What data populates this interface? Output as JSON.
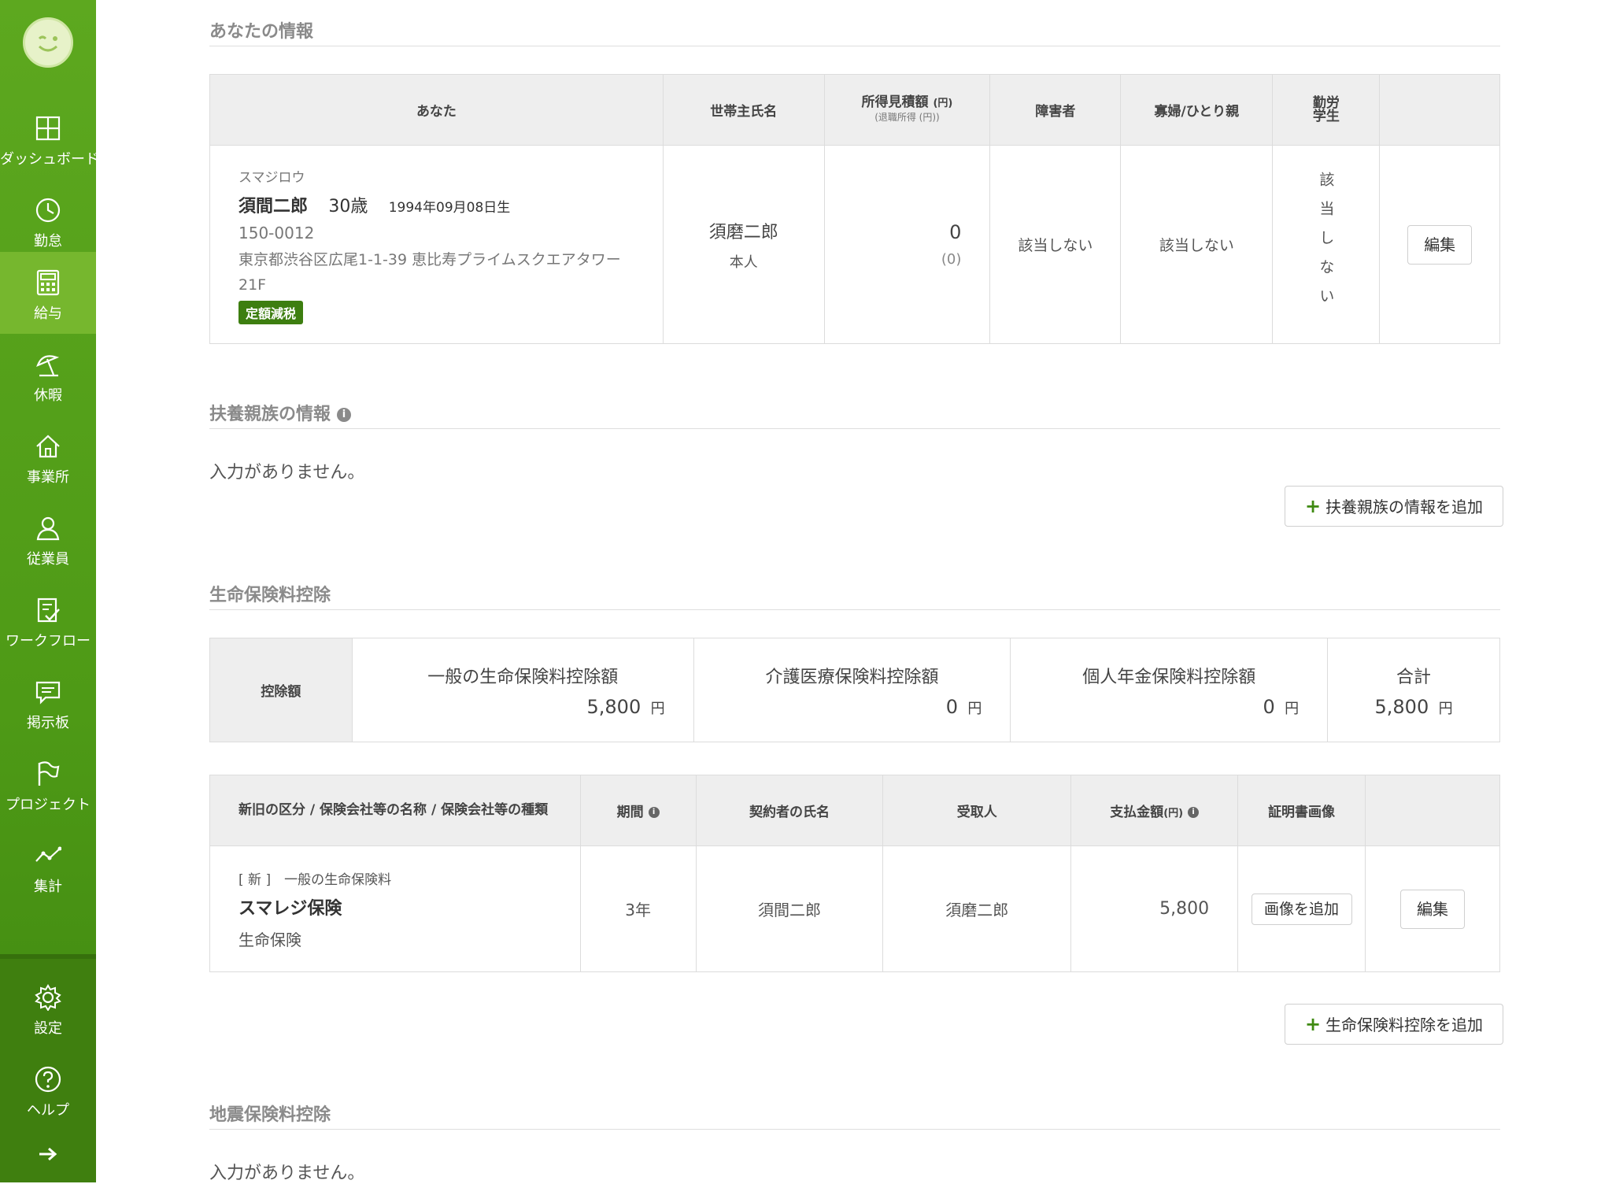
{
  "sidebar": {
    "items": [
      {
        "label": "ダッシュボード",
        "icon": "dashboard-icon"
      },
      {
        "label": "勤怠",
        "icon": "clock-icon"
      },
      {
        "label": "給与",
        "icon": "calculator-icon"
      },
      {
        "label": "休暇",
        "icon": "umbrella-icon"
      },
      {
        "label": "事業所",
        "icon": "home-icon"
      },
      {
        "label": "従業員",
        "icon": "user-icon"
      },
      {
        "label": "ワークフロー",
        "icon": "checklist-icon"
      },
      {
        "label": "掲示板",
        "icon": "chat-icon"
      },
      {
        "label": "プロジェクト",
        "icon": "flag-icon"
      },
      {
        "label": "集計",
        "icon": "line-chart-icon"
      }
    ],
    "bottom": [
      {
        "label": "設定",
        "icon": "gear-icon"
      },
      {
        "label": "ヘルプ",
        "icon": "help-icon"
      }
    ],
    "active": "給与"
  },
  "you": {
    "title": "あなたの情報",
    "headers": {
      "you": "あなた",
      "household": "世帯主氏名",
      "income": "所得見積額",
      "income_unit": "(円)",
      "income_sub": "(退職所得 (円))",
      "disability": "障害者",
      "widow": "寡婦/ひとり親",
      "student": "勤労\n学生"
    },
    "row": {
      "kana": "スマジロウ",
      "name": "須間二郎",
      "age": "30歳",
      "birth": "1994年09月08日生",
      "postal": "150-0012",
      "address": "東京都渋谷区広尾1-1-39 恵比寿プライムスクエアタワー21F",
      "badge": "定額減税",
      "household_name": "須磨二郎",
      "household_relation": "本人",
      "income": "0",
      "income_retire": "(0)",
      "disability": "該当しない",
      "widow": "該当しない",
      "student": "該当しない",
      "edit": "編集"
    }
  },
  "dependents": {
    "title": "扶養親族の情報",
    "empty": "入力がありません。",
    "add": "扶養親族の情報を追加"
  },
  "life": {
    "title": "生命保険料控除",
    "summary": {
      "label": "控除額",
      "general_label": "一般の生命保険料控除額",
      "general_value": "5,800",
      "care_label": "介護医療保険料控除額",
      "care_value": "0",
      "pension_label": "個人年金保険料控除額",
      "pension_value": "0",
      "total_label": "合計",
      "total_value": "5,800",
      "yen": "円"
    },
    "headers": {
      "category": "新旧の区分 / 保険会社等の名称 / 保険会社等の種類",
      "period": "期間",
      "contractor": "契約者の氏名",
      "recipient": "受取人",
      "amount": "支払金額",
      "amount_unit": "(円)",
      "cert": "証明書画像"
    },
    "rows": [
      {
        "kind": "[ 新 ]　一般の生命保険料",
        "company": "スマレジ保険",
        "type": "生命保険",
        "period": "3年",
        "contractor": "須間二郎",
        "recipient": "須磨二郎",
        "amount": "5,800",
        "add_image": "画像を追加",
        "edit": "編集"
      }
    ],
    "add": "生命保険料控除を追加"
  },
  "earthquake": {
    "title": "地震保険料控除",
    "empty": "入力がありません。"
  }
}
